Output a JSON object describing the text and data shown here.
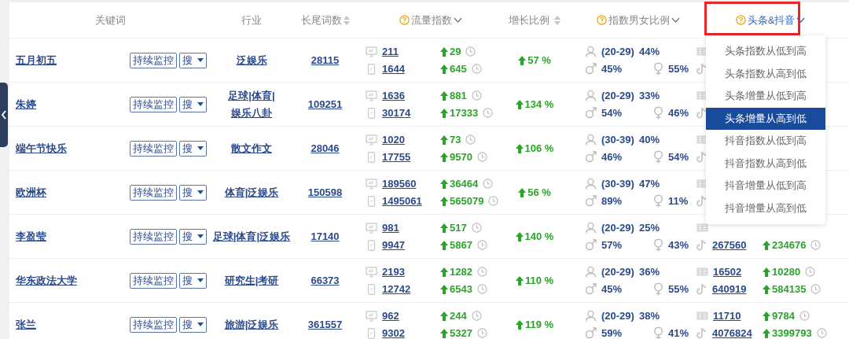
{
  "header": {
    "keyword": "关键词",
    "industry": "行业",
    "longtail": "长尾词数",
    "traffic": "流量指数",
    "growth": "增长比例",
    "gender": "指数男女比例",
    "platform": "头条&抖音"
  },
  "rows": [
    {
      "keyword": "五月初五",
      "monitor": "持续监控",
      "search": "搜",
      "industry": "泛娱乐",
      "longtail": "28115",
      "pc": "211",
      "mobile": "1644",
      "pc_delta": "29",
      "mobile_delta": "645",
      "growth": "57 %",
      "age": "(20-29)",
      "age_pct": "44%",
      "male": "45%",
      "female": "55%"
    },
    {
      "keyword": "朱婷",
      "monitor": "持续监控",
      "search": "搜",
      "industry": "足球|体育|娱乐八卦",
      "longtail": "109251",
      "pc": "1636",
      "mobile": "30174",
      "pc_delta": "881",
      "mobile_delta": "17333",
      "growth": "134 %",
      "age": "(20-29)",
      "age_pct": "33%",
      "male": "54%",
      "female": "46%"
    },
    {
      "keyword": "端午节快乐",
      "monitor": "持续监控",
      "search": "搜",
      "industry": "散文作文",
      "longtail": "28046",
      "pc": "1020",
      "mobile": "17755",
      "pc_delta": "73",
      "mobile_delta": "9570",
      "growth": "106 %",
      "age": "(30-39)",
      "age_pct": "40%",
      "male": "46%",
      "female": "54%"
    },
    {
      "keyword": "欧洲杯",
      "monitor": "持续监控",
      "search": "搜",
      "industry": "体育|泛娱乐",
      "longtail": "150598",
      "pc": "189560",
      "mobile": "1495061",
      "pc_delta": "36464",
      "mobile_delta": "565079",
      "growth": "56 %",
      "age": "(30-39)",
      "age_pct": "47%",
      "male": "89%",
      "female": "11%"
    },
    {
      "keyword": "李盈莹",
      "monitor": "持续监控",
      "search": "搜",
      "industry": "足球|体育|泛娱乐",
      "longtail": "17140",
      "pc": "981",
      "mobile": "9947",
      "pc_delta": "517",
      "mobile_delta": "5867",
      "growth": "140 %",
      "age": "(20-29)",
      "age_pct": "25%",
      "male": "57%",
      "female": "43%",
      "douyin": {
        "index": "267560",
        "delta": "234676"
      }
    },
    {
      "keyword": "华东政法大学",
      "monitor": "持续监控",
      "search": "搜",
      "industry": "研究生|考研",
      "longtail": "66373",
      "pc": "2193",
      "mobile": "12742",
      "pc_delta": "1282",
      "mobile_delta": "6543",
      "growth": "110 %",
      "age": "(20-29)",
      "age_pct": "36%",
      "male": "45%",
      "female": "55%",
      "toutiao": {
        "index": "16502",
        "delta": "10280"
      },
      "douyin": {
        "index": "640919",
        "delta": "584135"
      }
    },
    {
      "keyword": "张兰",
      "monitor": "持续监控",
      "search": "搜",
      "industry": "旅游|泛娱乐",
      "longtail": "361557",
      "pc": "962",
      "mobile": "9302",
      "pc_delta": "244",
      "mobile_delta": "5327",
      "growth": "119 %",
      "age": "(20-29)",
      "age_pct": "38%",
      "male": "59%",
      "female": "41%",
      "toutiao": {
        "index": "11710",
        "delta": "9784"
      },
      "douyin": {
        "index": "4076824",
        "delta": "3399793"
      }
    }
  ],
  "sort_menu": [
    {
      "label": "头条指数从低到高",
      "selected": false
    },
    {
      "label": "头条指数从高到低",
      "selected": false
    },
    {
      "label": "头条增量从低到高",
      "selected": false
    },
    {
      "label": "头条增量从高到低",
      "selected": true
    },
    {
      "label": "抖音指数从低到高",
      "selected": false
    },
    {
      "label": "抖音指数从高到低",
      "selected": false
    },
    {
      "label": "抖音增量从低到高",
      "selected": false
    },
    {
      "label": "抖音增量从高到低",
      "selected": false
    }
  ]
}
